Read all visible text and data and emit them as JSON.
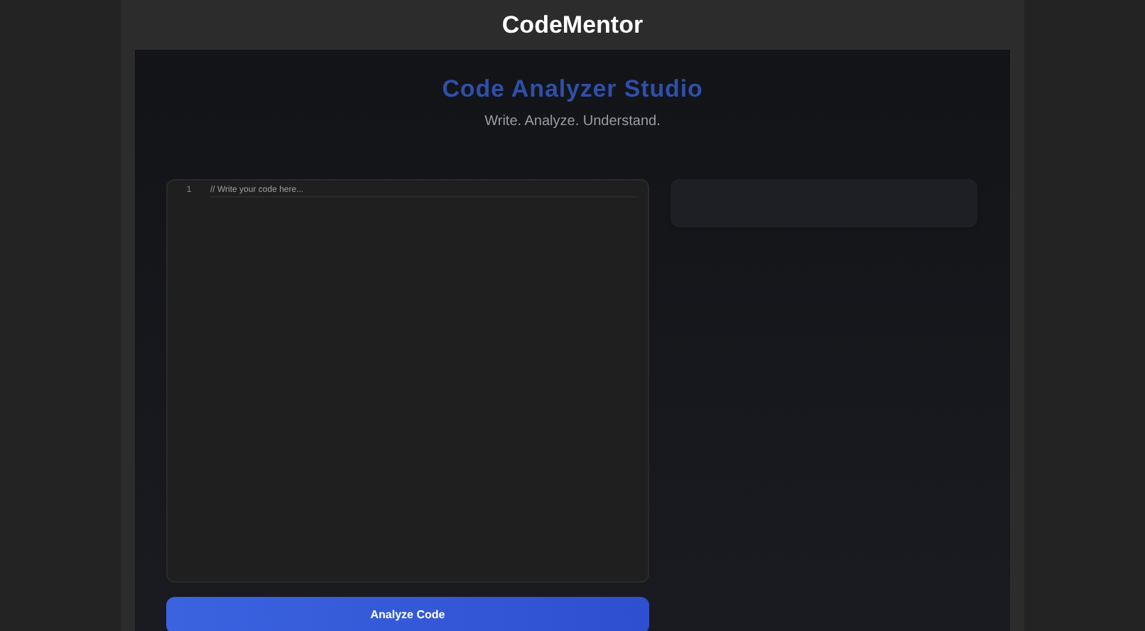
{
  "header": {
    "title": "CodeMentor"
  },
  "hero": {
    "title": "Code Analyzer Studio",
    "subtitle": "Write. Analyze. Understand."
  },
  "editor": {
    "line_numbers": [
      "1"
    ],
    "placeholder": "// Write your code here..."
  },
  "analyze_button": {
    "label": "Analyze Code"
  }
}
